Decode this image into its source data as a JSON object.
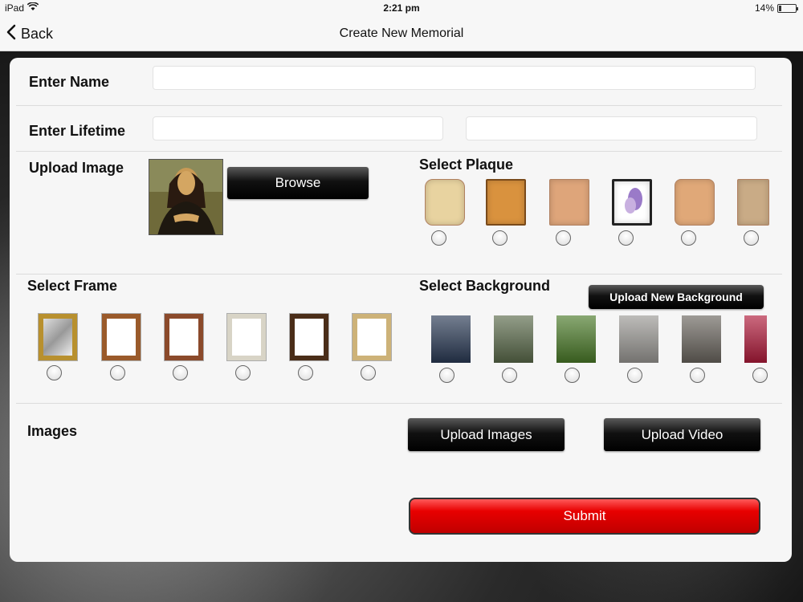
{
  "status_bar": {
    "device": "iPad",
    "time": "2:21 pm",
    "battery": "14%",
    "battery_level": 0.14
  },
  "nav": {
    "back_label": "Back",
    "title": "Create New Memorial"
  },
  "form": {
    "name_label": "Enter Name",
    "name_value": "",
    "lifetime_label": "Enter Lifetime",
    "lifetime_start": "",
    "lifetime_end": "",
    "upload_image_label": "Upload Image",
    "browse_label": "Browse",
    "select_plaque_label": "Select Plaque",
    "select_frame_label": "Select Frame",
    "select_background_label": "Select Background",
    "upload_background_label": "Upload New Background",
    "images_label": "Images",
    "upload_images_label": "Upload Images",
    "upload_video_label": "Upload Video",
    "submit_label": "Submit"
  },
  "plaques": [
    {
      "name": "cream-scroll-plaque",
      "color": "#e8d3a0"
    },
    {
      "name": "orange-wood-plaque",
      "color": "#d9923e"
    },
    {
      "name": "light-wood-plaque",
      "color": "#dea57a"
    },
    {
      "name": "flower-plaque",
      "color": "#ffffff"
    },
    {
      "name": "octagon-wood-plaque",
      "color": "#e0a878"
    },
    {
      "name": "sand-plaque",
      "color": "#c9ab86"
    }
  ],
  "frames": [
    {
      "name": "gold-mirror-frame",
      "color": "#b8902e"
    },
    {
      "name": "ornate-copper-frame",
      "color": "#9a5a2a"
    },
    {
      "name": "brown-wood-frame",
      "color": "#8b4a2b"
    },
    {
      "name": "floral-frame",
      "color": "#d8d4c6"
    },
    {
      "name": "dark-wood-frame",
      "color": "#4a2d18"
    },
    {
      "name": "gilded-frame",
      "color": "#cdb278"
    }
  ],
  "backgrounds": [
    {
      "name": "misty-figures-background",
      "color": "#2a3a55"
    },
    {
      "name": "ruins-background",
      "color": "#5a6a4a"
    },
    {
      "name": "green-field-background",
      "color": "#4a7a28"
    },
    {
      "name": "stone-stairs-background",
      "color": "#9a9894"
    },
    {
      "name": "stone-alley-background",
      "color": "#6a655e"
    },
    {
      "name": "red-flowers-background",
      "color": "#b01a3a"
    }
  ]
}
